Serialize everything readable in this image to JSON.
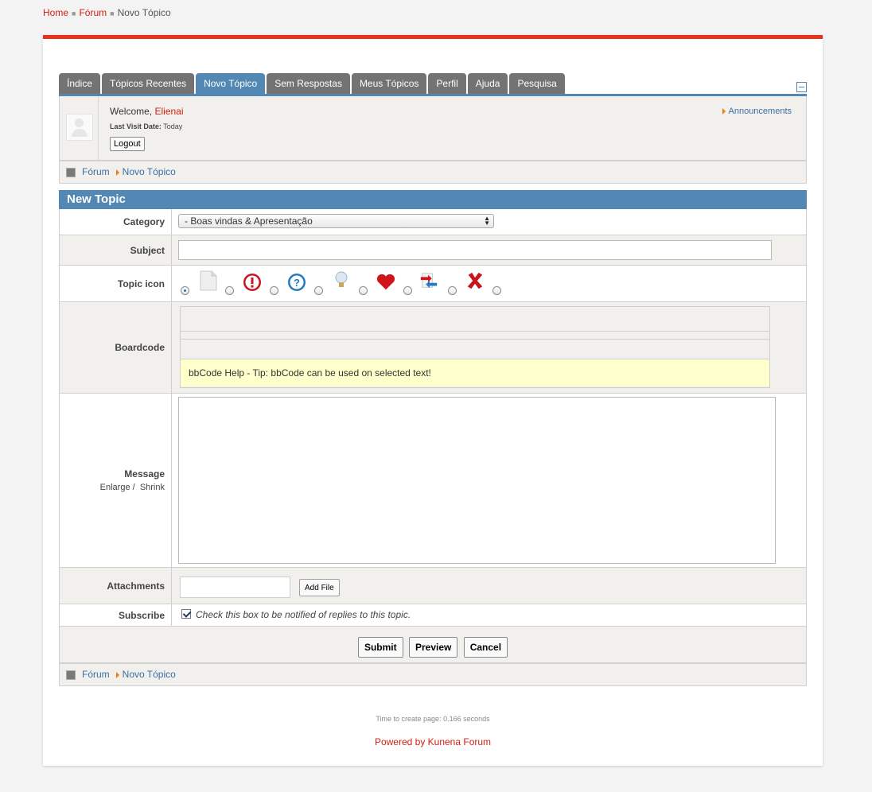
{
  "top_breadcrumb": {
    "home": "Home",
    "forum": "Fórum",
    "current": "Novo Tópico"
  },
  "tabs": [
    {
      "label": "Índice"
    },
    {
      "label": "Tópicos Recentes"
    },
    {
      "label": "Novo Tópico",
      "active": true
    },
    {
      "label": "Sem Respostas"
    },
    {
      "label": "Meus Tópicos"
    },
    {
      "label": "Perfil"
    },
    {
      "label": "Ajuda"
    },
    {
      "label": "Pesquisa"
    }
  ],
  "profile": {
    "welcome": "Welcome,",
    "username": "Elienai",
    "last_visit_label": "Last Visit Date:",
    "last_visit_value": "Today",
    "logout_label": "Logout",
    "announcements": "Announcements"
  },
  "pathway": {
    "forum": "Fórum",
    "current": "Novo Tópico"
  },
  "form": {
    "title": "New Topic",
    "category_label": "Category",
    "category_value": "- Boas vindas & Apresentação",
    "subject_label": "Subject",
    "subject_value": "",
    "topic_icon_label": "Topic icon",
    "topic_icons": [
      "default-page-icon",
      "exclamation-icon",
      "question-icon",
      "lightbulb-icon",
      "heart-icon",
      "arrows-icon",
      "red-x-icon"
    ],
    "boardcode_label": "Boardcode",
    "bbcode_help": "bbCode Help - Tip: bbCode can be used on selected text!",
    "message_label": "Message",
    "enlarge": "Enlarge",
    "shrink": "Shrink",
    "attachments_label": "Attachments",
    "add_file": "Add File",
    "subscribe_label": "Subscribe",
    "subscribe_text": "Check this box to be notified of replies to this topic.",
    "submit": "Submit",
    "preview": "Preview",
    "cancel": "Cancel"
  },
  "footer": {
    "time": "Time to create page: 0.166 seconds",
    "powered": "Powered by Kunena Forum"
  },
  "colors": {
    "accent_red": "#e8331a",
    "tab_blue": "#5388b4",
    "tab_gray": "#737373",
    "link_red": "#d21e10"
  }
}
